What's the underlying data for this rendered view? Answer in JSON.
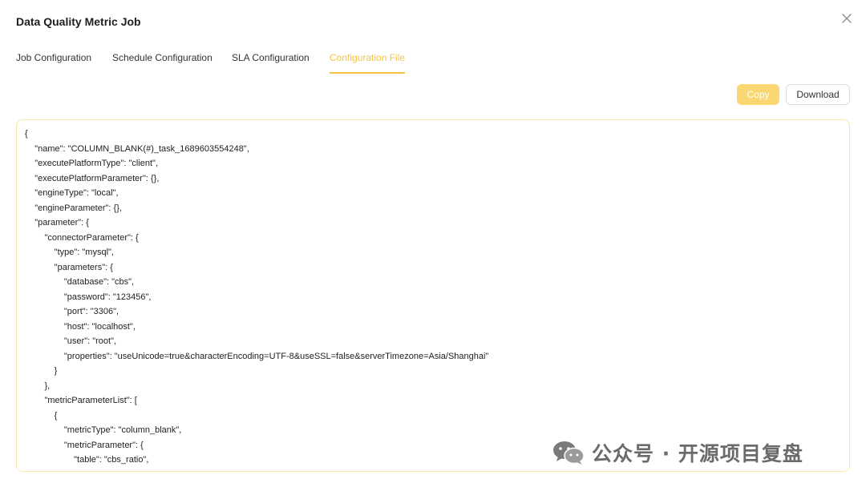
{
  "dialog": {
    "title": "Data Quality Metric Job",
    "close_icon": "close-icon"
  },
  "tabs": [
    {
      "label": "Job Configuration",
      "active": false
    },
    {
      "label": "Schedule Configuration",
      "active": false
    },
    {
      "label": "SLA Configuration",
      "active": false
    },
    {
      "label": "Configuration File",
      "active": true
    }
  ],
  "actions": {
    "copy_label": "Copy",
    "download_label": "Download"
  },
  "config_file": {
    "lines": [
      "{",
      "    \"name\": \"COLUMN_BLANK(#)_task_1689603554248\",",
      "    \"executePlatformType\": \"client\",",
      "    \"executePlatformParameter\": {},",
      "    \"engineType\": \"local\",",
      "    \"engineParameter\": {},",
      "    \"parameter\": {",
      "        \"connectorParameter\": {",
      "            \"type\": \"mysql\",",
      "            \"parameters\": {",
      "                \"database\": \"cbs\",",
      "                \"password\": \"123456\",",
      "                \"port\": \"3306\",",
      "                \"host\": \"localhost\",",
      "                \"user\": \"root\",",
      "                \"properties\": \"useUnicode=true&characterEncoding=UTF-8&useSSL=false&serverTimezone=Asia/Shanghai\"",
      "            }",
      "        },",
      "        \"metricParameterList\": [",
      "            {",
      "                \"metricType\": \"column_blank\",",
      "                \"metricParameter\": {",
      "                    \"table\": \"cbs_ratio\","
    ]
  },
  "watermark": {
    "text": "公众号 · 开源项目复盘",
    "icon": "wechat-icon"
  },
  "colors": {
    "accent": "#f6c443",
    "copy_button_bg": "#fbd772",
    "code_border": "#f8e7a8"
  }
}
